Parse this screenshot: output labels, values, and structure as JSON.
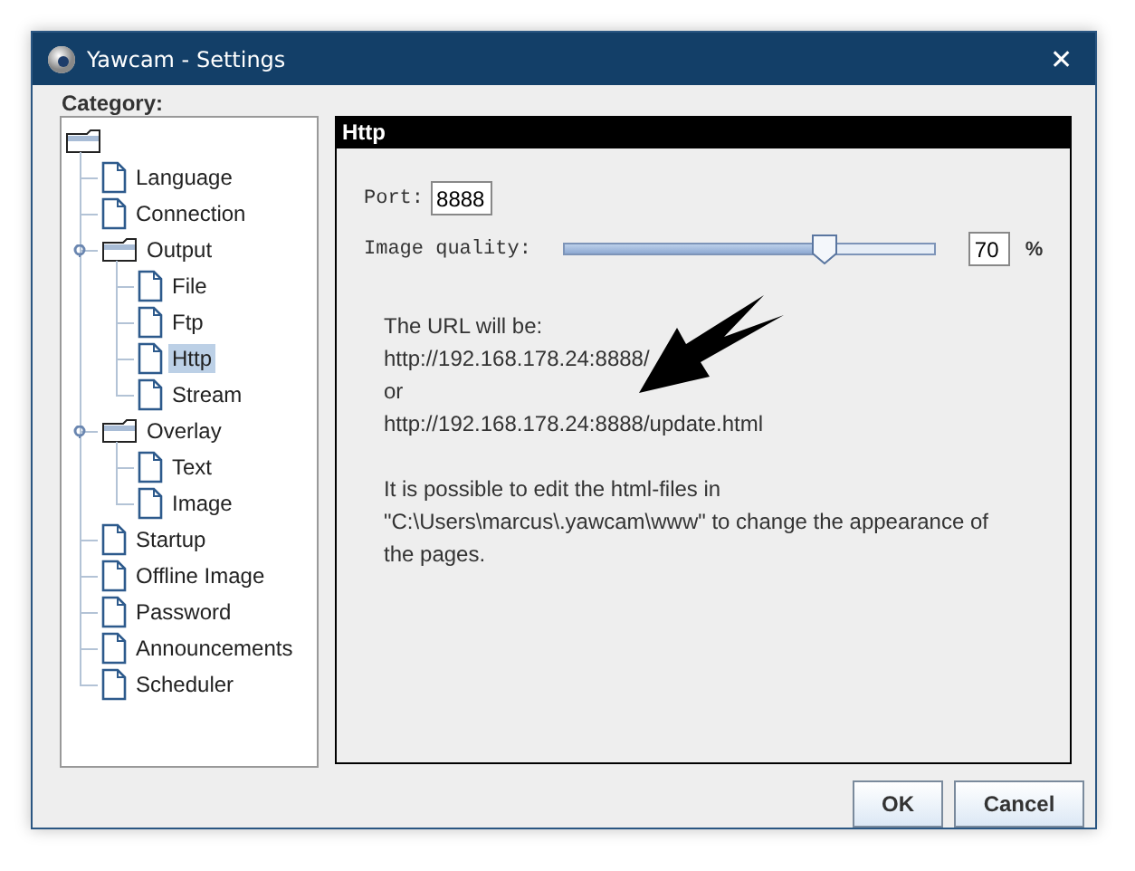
{
  "window": {
    "title": "Yawcam - Settings",
    "close": "✕"
  },
  "category_label": "Category:",
  "tree": {
    "kind": "folder",
    "children": [
      {
        "kind": "leaf",
        "label": "Language",
        "selected": false
      },
      {
        "kind": "leaf",
        "label": "Connection",
        "selected": false
      },
      {
        "kind": "folder",
        "label": "Output",
        "selected": false,
        "expanded": true,
        "children": [
          {
            "kind": "leaf",
            "label": "File",
            "selected": false
          },
          {
            "kind": "leaf",
            "label": "Ftp",
            "selected": false
          },
          {
            "kind": "leaf",
            "label": "Http",
            "selected": true
          },
          {
            "kind": "leaf",
            "label": "Stream",
            "selected": false
          }
        ]
      },
      {
        "kind": "folder",
        "label": "Overlay",
        "selected": false,
        "expanded": true,
        "children": [
          {
            "kind": "leaf",
            "label": "Text",
            "selected": false
          },
          {
            "kind": "leaf",
            "label": "Image",
            "selected": false
          }
        ]
      },
      {
        "kind": "leaf",
        "label": "Startup",
        "selected": false
      },
      {
        "kind": "leaf",
        "label": "Offline Image",
        "selected": false
      },
      {
        "kind": "leaf",
        "label": "Password",
        "selected": false
      },
      {
        "kind": "leaf",
        "label": "Announcements",
        "selected": false
      },
      {
        "kind": "leaf",
        "label": "Scheduler",
        "selected": false
      }
    ]
  },
  "panel": {
    "title": "Http",
    "port": {
      "label": "Port:",
      "value": "8888"
    },
    "quality": {
      "label": "Image quality:",
      "level": 0.7,
      "value": "70",
      "unit": "%"
    },
    "url_lines": [
      "The URL will be:",
      "http://192.168.178.24:8888/",
      "or",
      "http://192.168.178.24:8888/update.html"
    ],
    "note_lines": [
      "It is possible to edit the html-files in",
      "\"C:\\Users\\marcus\\.yawcam\\www\" to change the appearance of",
      "the pages."
    ]
  },
  "buttons": [
    "OK",
    "Cancel"
  ]
}
